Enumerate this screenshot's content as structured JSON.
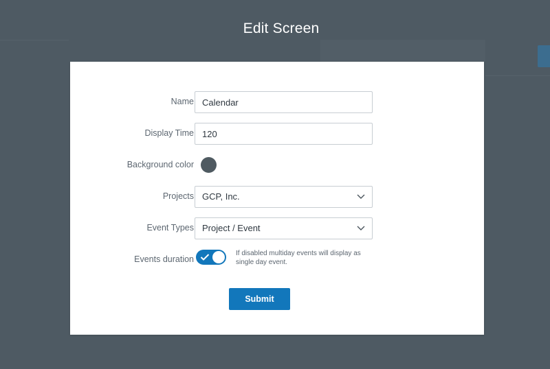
{
  "modal": {
    "title": "Edit Screen",
    "fields": {
      "name": {
        "label": "Name",
        "value": "Calendar"
      },
      "display_time": {
        "label": "Display Time",
        "value": "120"
      },
      "background_color": {
        "label": "Background color",
        "color": "#4f5a61"
      },
      "projects": {
        "label": "Projects",
        "selected": "GCP, Inc."
      },
      "event_types": {
        "label": "Event Types",
        "selected": "Project / Event"
      },
      "events_duration": {
        "label": "Events duration",
        "enabled": true,
        "helper": "If disabled multiday events will display as single day event."
      }
    },
    "submit_label": "Submit"
  },
  "colors": {
    "accent": "#1277bb",
    "overlay": "#4e5a63"
  },
  "icons": {
    "select_arrow": "chevron-down-icon",
    "toggle_check": "check-icon"
  }
}
